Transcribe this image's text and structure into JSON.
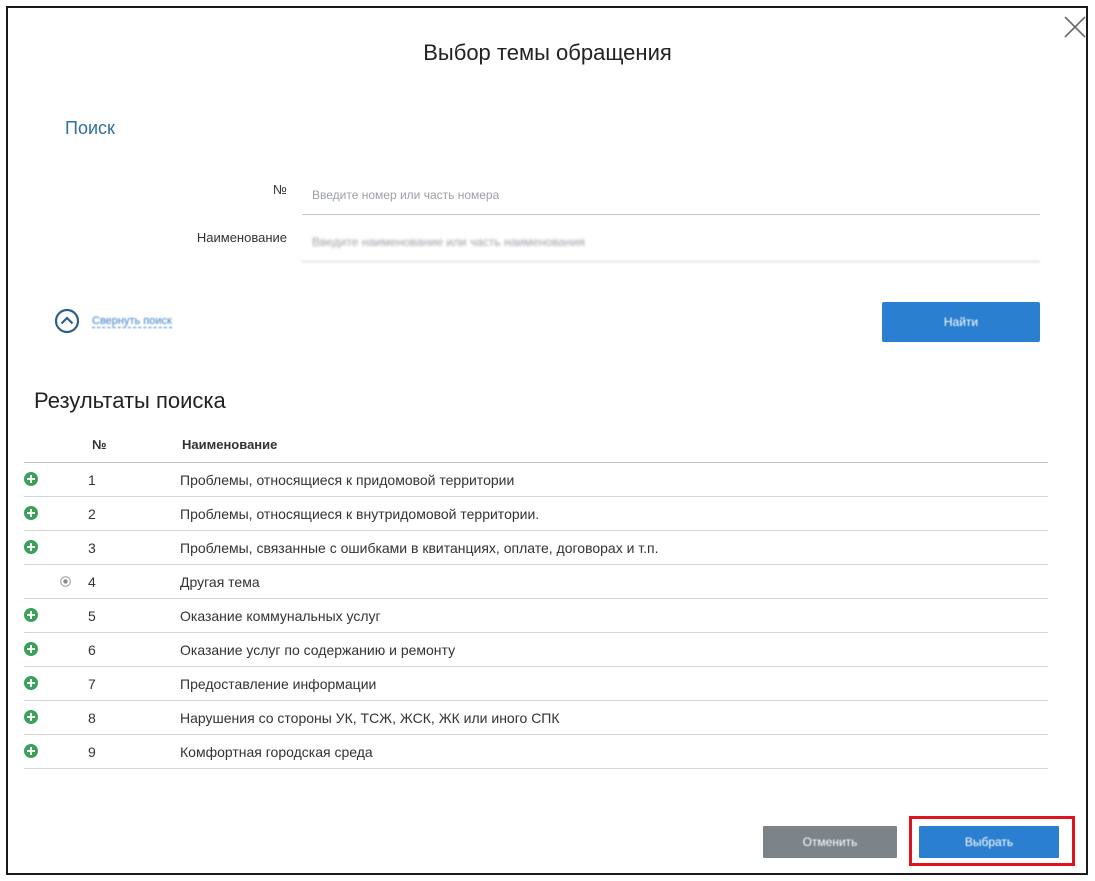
{
  "dialog": {
    "title": "Выбор темы обращения",
    "close_icon": "close-icon"
  },
  "search": {
    "heading": "Поиск",
    "num_label": "№",
    "num_placeholder": "Введите номер или часть номера",
    "name_label": "Наименование",
    "name_placeholder": "Введите наименование или часть наименования",
    "collapse_label": "Свернуть поиск",
    "collapse_icon": "chevron-up-circle-icon",
    "find_button": "Найти"
  },
  "results": {
    "heading": "Результаты поиска",
    "columns": {
      "num": "№",
      "name": "Наименование"
    },
    "rows": [
      {
        "num": "1",
        "name": "Проблемы, относящиеся к придомовой территории",
        "icon": "expand-plus-icon"
      },
      {
        "num": "2",
        "name": "Проблемы, относящиеся к внутридомовой территории.",
        "icon": "expand-plus-icon"
      },
      {
        "num": "3",
        "name": "Проблемы, связанные с ошибками в квитанциях, оплате, договорах и т.п.",
        "icon": "expand-plus-icon"
      },
      {
        "num": "4",
        "name": "Другая тема",
        "icon": "radio-selected-icon"
      },
      {
        "num": "5",
        "name": "Оказание коммунальных услуг",
        "icon": "expand-plus-icon"
      },
      {
        "num": "6",
        "name": "Оказание услуг по содержанию и ремонту",
        "icon": "expand-plus-icon"
      },
      {
        "num": "7",
        "name": "Предоставление информации",
        "icon": "expand-plus-icon"
      },
      {
        "num": "8",
        "name": "Нарушения со стороны УК, ТСЖ, ЖСК, ЖК или иного СПК",
        "icon": "expand-plus-icon"
      },
      {
        "num": "9",
        "name": "Комфортная городская среда",
        "icon": "expand-plus-icon"
      }
    ]
  },
  "footer": {
    "cancel_button": "Отменить",
    "select_button": "Выбрать"
  },
  "colors": {
    "accent": "#2b7fd0",
    "link": "#2f6f9f",
    "expand_icon": "#3aa15a",
    "cancel_button": "#7c8389",
    "highlight": "#e0141e"
  }
}
